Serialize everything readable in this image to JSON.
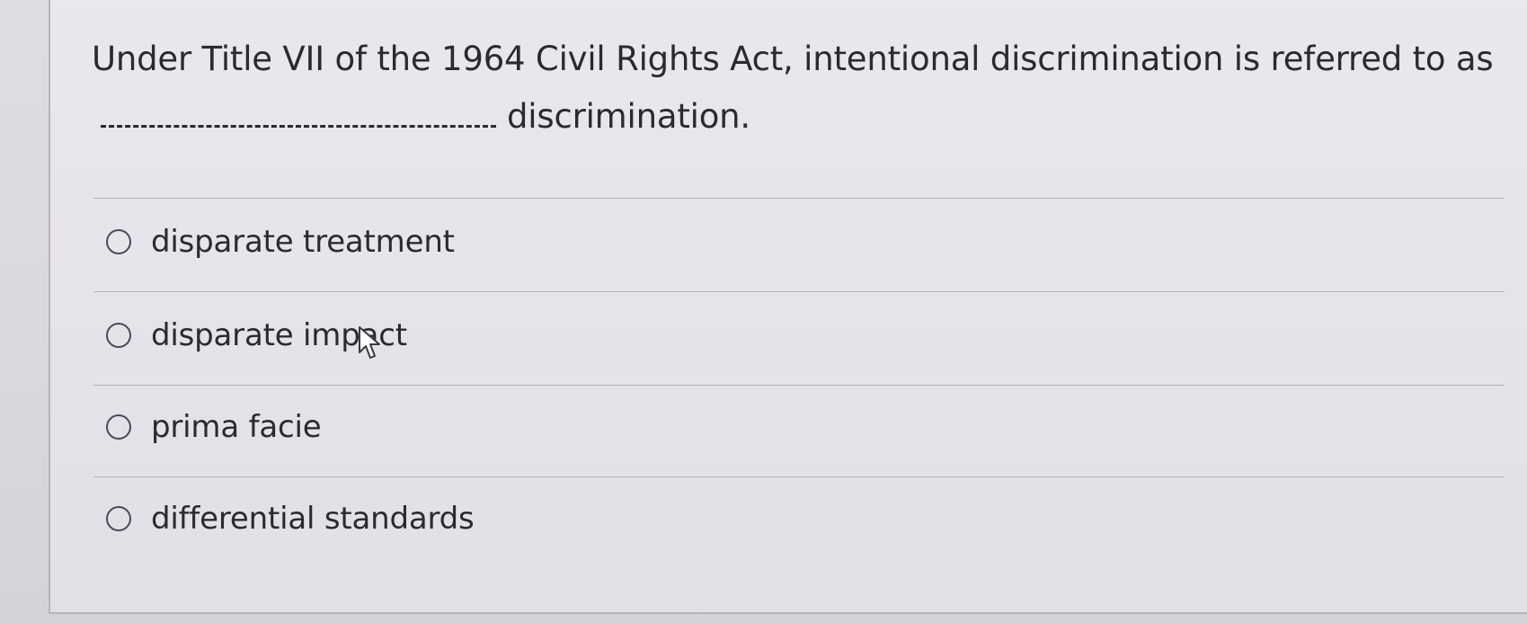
{
  "question": {
    "text_before": "Under Title VII of the 1964 Civil Rights Act, intentional discrimination is referred to as",
    "text_after": "discrimination."
  },
  "options": [
    {
      "label": "disparate treatment",
      "selected": false
    },
    {
      "label": "disparate impact",
      "selected": false
    },
    {
      "label": "prima facie",
      "selected": false
    },
    {
      "label": "differential standards",
      "selected": false
    }
  ],
  "icons": {
    "cursor": "arrow-cursor-icon",
    "radio": "radio-button-icon"
  }
}
